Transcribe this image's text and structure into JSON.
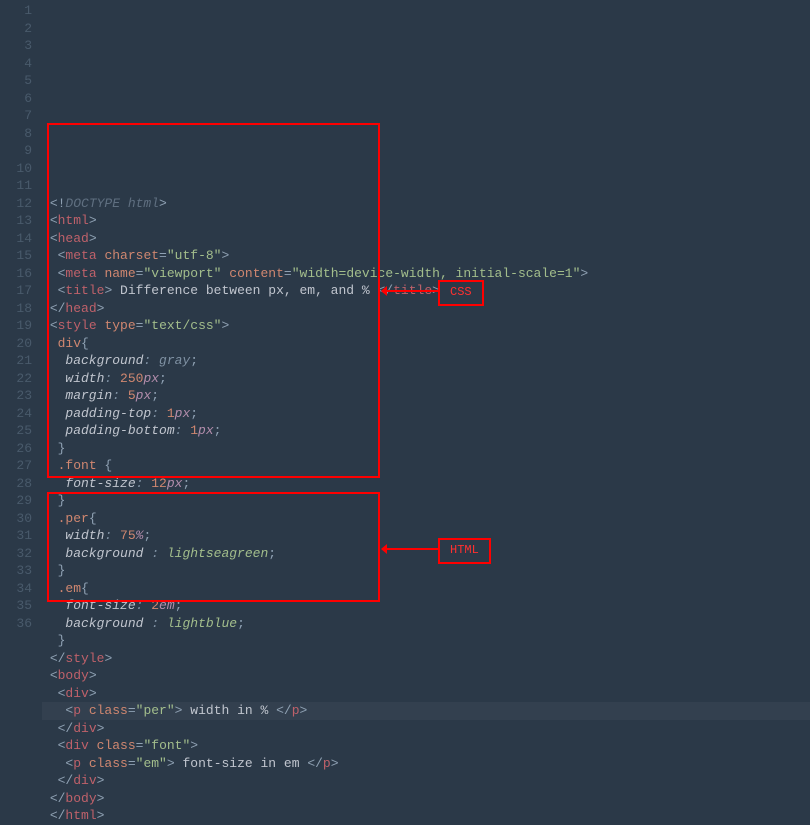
{
  "annotations": {
    "css_label": "CSS",
    "html_label": "HTML"
  },
  "lines": [
    {
      "n": 1,
      "segs": [
        {
          "t": " ",
          "c": ""
        },
        {
          "t": "<!",
          "c": "c-punct"
        },
        {
          "t": "DOCTYPE html",
          "c": "c-gray"
        },
        {
          "t": ">",
          "c": "c-punct"
        }
      ]
    },
    {
      "n": 2,
      "segs": [
        {
          "t": " ",
          "c": ""
        },
        {
          "t": "<",
          "c": "c-punct"
        },
        {
          "t": "html",
          "c": "c-tag"
        },
        {
          "t": ">",
          "c": "c-punct"
        }
      ]
    },
    {
      "n": 3,
      "segs": [
        {
          "t": " ",
          "c": ""
        },
        {
          "t": "<",
          "c": "c-punct"
        },
        {
          "t": "head",
          "c": "c-tag"
        },
        {
          "t": ">",
          "c": "c-punct"
        }
      ]
    },
    {
      "n": 4,
      "segs": [
        {
          "t": "  ",
          "c": ""
        },
        {
          "t": "<",
          "c": "c-punct"
        },
        {
          "t": "meta ",
          "c": "c-tag"
        },
        {
          "t": "charset",
          "c": "c-attr"
        },
        {
          "t": "=",
          "c": "c-punct"
        },
        {
          "t": "\"utf-8\"",
          "c": "c-str"
        },
        {
          "t": ">",
          "c": "c-punct"
        }
      ]
    },
    {
      "n": 5,
      "segs": [
        {
          "t": "  ",
          "c": ""
        },
        {
          "t": "<",
          "c": "c-punct"
        },
        {
          "t": "meta ",
          "c": "c-tag"
        },
        {
          "t": "name",
          "c": "c-attr"
        },
        {
          "t": "=",
          "c": "c-punct"
        },
        {
          "t": "\"viewport\"",
          "c": "c-str"
        },
        {
          "t": " ",
          "c": ""
        },
        {
          "t": "content",
          "c": "c-attr"
        },
        {
          "t": "=",
          "c": "c-punct"
        },
        {
          "t": "\"width=device-width, initial-scale=1\"",
          "c": "c-str"
        },
        {
          "t": ">",
          "c": "c-punct"
        }
      ]
    },
    {
      "n": 6,
      "segs": [
        {
          "t": "  ",
          "c": ""
        },
        {
          "t": "<",
          "c": "c-punct"
        },
        {
          "t": "title",
          "c": "c-tag"
        },
        {
          "t": ">",
          "c": "c-punct"
        },
        {
          "t": " Difference between px, em, and % ",
          "c": "c-text"
        },
        {
          "t": "</",
          "c": "c-punct"
        },
        {
          "t": "title",
          "c": "c-tag"
        },
        {
          "t": ">",
          "c": "c-punct"
        }
      ]
    },
    {
      "n": 7,
      "segs": [
        {
          "t": " ",
          "c": ""
        },
        {
          "t": "</",
          "c": "c-punct"
        },
        {
          "t": "head",
          "c": "c-tag"
        },
        {
          "t": ">",
          "c": "c-punct"
        }
      ]
    },
    {
      "n": 8,
      "segs": [
        {
          "t": " ",
          "c": ""
        },
        {
          "t": "<",
          "c": "c-punct"
        },
        {
          "t": "style ",
          "c": "c-tag"
        },
        {
          "t": "type",
          "c": "c-attr"
        },
        {
          "t": "=",
          "c": "c-punct"
        },
        {
          "t": "\"text/css\"",
          "c": "c-str"
        },
        {
          "t": ">",
          "c": "c-punct"
        }
      ]
    },
    {
      "n": 9,
      "segs": [
        {
          "t": "  ",
          "c": ""
        },
        {
          "t": "div",
          "c": "c-sel"
        },
        {
          "t": "{",
          "c": "c-punct"
        }
      ]
    },
    {
      "n": 10,
      "segs": [
        {
          "t": "   ",
          "c": ""
        },
        {
          "t": "background",
          "c": "c-prop"
        },
        {
          "t": ": ",
          "c": "c-kw"
        },
        {
          "t": "gray",
          "c": "c-kw"
        },
        {
          "t": ";",
          "c": "c-punct"
        }
      ]
    },
    {
      "n": 11,
      "segs": [
        {
          "t": "   ",
          "c": ""
        },
        {
          "t": "width",
          "c": "c-prop"
        },
        {
          "t": ": ",
          "c": "c-kw"
        },
        {
          "t": "250",
          "c": "c-num"
        },
        {
          "t": "px",
          "c": "c-unit"
        },
        {
          "t": ";",
          "c": "c-punct"
        }
      ]
    },
    {
      "n": 12,
      "segs": [
        {
          "t": "   ",
          "c": ""
        },
        {
          "t": "margin",
          "c": "c-prop"
        },
        {
          "t": ": ",
          "c": "c-kw"
        },
        {
          "t": "5",
          "c": "c-num"
        },
        {
          "t": "px",
          "c": "c-unit"
        },
        {
          "t": ";",
          "c": "c-punct"
        }
      ]
    },
    {
      "n": 13,
      "segs": [
        {
          "t": "   ",
          "c": ""
        },
        {
          "t": "padding-top",
          "c": "c-prop"
        },
        {
          "t": ": ",
          "c": "c-kw"
        },
        {
          "t": "1",
          "c": "c-num"
        },
        {
          "t": "px",
          "c": "c-unit"
        },
        {
          "t": ";",
          "c": "c-punct"
        }
      ]
    },
    {
      "n": 14,
      "segs": [
        {
          "t": "   ",
          "c": ""
        },
        {
          "t": "padding-bottom",
          "c": "c-prop"
        },
        {
          "t": ": ",
          "c": "c-kw"
        },
        {
          "t": "1",
          "c": "c-num"
        },
        {
          "t": "px",
          "c": "c-unit"
        },
        {
          "t": ";",
          "c": "c-punct"
        }
      ]
    },
    {
      "n": 15,
      "segs": [
        {
          "t": "  ",
          "c": ""
        },
        {
          "t": "}",
          "c": "c-punct"
        }
      ]
    },
    {
      "n": 16,
      "segs": [
        {
          "t": "  ",
          "c": ""
        },
        {
          "t": ".font ",
          "c": "c-sel"
        },
        {
          "t": "{",
          "c": "c-punct"
        }
      ]
    },
    {
      "n": 17,
      "segs": [
        {
          "t": "   ",
          "c": ""
        },
        {
          "t": "font-size",
          "c": "c-prop"
        },
        {
          "t": ": ",
          "c": "c-kw"
        },
        {
          "t": "12",
          "c": "c-num"
        },
        {
          "t": "px",
          "c": "c-unit"
        },
        {
          "t": ";",
          "c": "c-punct"
        }
      ]
    },
    {
      "n": 18,
      "segs": [
        {
          "t": "  ",
          "c": ""
        },
        {
          "t": "}",
          "c": "c-punct"
        }
      ]
    },
    {
      "n": 19,
      "segs": [
        {
          "t": "  ",
          "c": ""
        },
        {
          "t": ".per",
          "c": "c-sel"
        },
        {
          "t": "{",
          "c": "c-punct"
        }
      ]
    },
    {
      "n": 20,
      "segs": [
        {
          "t": "   ",
          "c": ""
        },
        {
          "t": "width",
          "c": "c-prop"
        },
        {
          "t": ": ",
          "c": "c-kw"
        },
        {
          "t": "75",
          "c": "c-num"
        },
        {
          "t": "%",
          "c": "c-unit"
        },
        {
          "t": ";",
          "c": "c-punct"
        }
      ]
    },
    {
      "n": 21,
      "segs": [
        {
          "t": "   ",
          "c": ""
        },
        {
          "t": "background ",
          "c": "c-prop"
        },
        {
          "t": ": ",
          "c": "c-kw"
        },
        {
          "t": "lightseagreen",
          "c": "c-val"
        },
        {
          "t": ";",
          "c": "c-punct"
        }
      ]
    },
    {
      "n": 22,
      "segs": [
        {
          "t": "  ",
          "c": ""
        },
        {
          "t": "}",
          "c": "c-punct"
        }
      ]
    },
    {
      "n": 23,
      "segs": [
        {
          "t": "  ",
          "c": ""
        },
        {
          "t": ".em",
          "c": "c-sel"
        },
        {
          "t": "{",
          "c": "c-punct"
        }
      ]
    },
    {
      "n": 24,
      "segs": [
        {
          "t": "   ",
          "c": ""
        },
        {
          "t": "font-size",
          "c": "c-prop"
        },
        {
          "t": ": ",
          "c": "c-kw"
        },
        {
          "t": "2",
          "c": "c-num"
        },
        {
          "t": "em",
          "c": "c-unit"
        },
        {
          "t": ";",
          "c": "c-punct"
        }
      ]
    },
    {
      "n": 25,
      "segs": [
        {
          "t": "   ",
          "c": ""
        },
        {
          "t": "background ",
          "c": "c-prop"
        },
        {
          "t": ": ",
          "c": "c-kw"
        },
        {
          "t": "lightblue",
          "c": "c-val"
        },
        {
          "t": ";",
          "c": "c-punct"
        }
      ]
    },
    {
      "n": 26,
      "segs": [
        {
          "t": "  ",
          "c": ""
        },
        {
          "t": "}",
          "c": "c-punct"
        }
      ]
    },
    {
      "n": 27,
      "segs": [
        {
          "t": " ",
          "c": ""
        },
        {
          "t": "</",
          "c": "c-punct"
        },
        {
          "t": "style",
          "c": "c-tag"
        },
        {
          "t": ">",
          "c": "c-punct"
        }
      ]
    },
    {
      "n": 28,
      "segs": [
        {
          "t": " ",
          "c": ""
        },
        {
          "t": "<",
          "c": "c-punct"
        },
        {
          "t": "body",
          "c": "c-tag"
        },
        {
          "t": ">",
          "c": "c-punct"
        }
      ]
    },
    {
      "n": 29,
      "segs": [
        {
          "t": "  ",
          "c": ""
        },
        {
          "t": "<",
          "c": "c-punct"
        },
        {
          "t": "div",
          "c": "c-tag"
        },
        {
          "t": ">",
          "c": "c-punct"
        }
      ]
    },
    {
      "n": 30,
      "hl": true,
      "segs": [
        {
          "t": "   ",
          "c": ""
        },
        {
          "t": "<",
          "c": "c-punct"
        },
        {
          "t": "p ",
          "c": "c-tag"
        },
        {
          "t": "class",
          "c": "c-attr"
        },
        {
          "t": "=",
          "c": "c-punct"
        },
        {
          "t": "\"per\"",
          "c": "c-str"
        },
        {
          "t": ">",
          "c": "c-punct"
        },
        {
          "t": " width in % ",
          "c": "c-text"
        },
        {
          "t": "</",
          "c": "c-punct"
        },
        {
          "t": "p",
          "c": "c-tag"
        },
        {
          "t": ">",
          "c": "c-punct"
        }
      ]
    },
    {
      "n": 31,
      "segs": [
        {
          "t": "  ",
          "c": ""
        },
        {
          "t": "</",
          "c": "c-punct"
        },
        {
          "t": "div",
          "c": "c-tag"
        },
        {
          "t": ">",
          "c": "c-punct"
        }
      ]
    },
    {
      "n": 32,
      "segs": [
        {
          "t": "  ",
          "c": ""
        },
        {
          "t": "<",
          "c": "c-punct"
        },
        {
          "t": "div ",
          "c": "c-tag"
        },
        {
          "t": "class",
          "c": "c-attr"
        },
        {
          "t": "=",
          "c": "c-punct"
        },
        {
          "t": "\"font\"",
          "c": "c-str"
        },
        {
          "t": ">",
          "c": "c-punct"
        }
      ]
    },
    {
      "n": 33,
      "segs": [
        {
          "t": "   ",
          "c": ""
        },
        {
          "t": "<",
          "c": "c-punct"
        },
        {
          "t": "p ",
          "c": "c-tag"
        },
        {
          "t": "class",
          "c": "c-attr"
        },
        {
          "t": "=",
          "c": "c-punct"
        },
        {
          "t": "\"em\"",
          "c": "c-str"
        },
        {
          "t": ">",
          "c": "c-punct"
        },
        {
          "t": " font-size in em ",
          "c": "c-text"
        },
        {
          "t": "</",
          "c": "c-punct"
        },
        {
          "t": "p",
          "c": "c-tag"
        },
        {
          "t": ">",
          "c": "c-punct"
        }
      ]
    },
    {
      "n": 34,
      "segs": [
        {
          "t": "  ",
          "c": ""
        },
        {
          "t": "</",
          "c": "c-punct"
        },
        {
          "t": "div",
          "c": "c-tag"
        },
        {
          "t": ">",
          "c": "c-punct"
        }
      ]
    },
    {
      "n": 35,
      "segs": [
        {
          "t": " ",
          "c": ""
        },
        {
          "t": "</",
          "c": "c-punct"
        },
        {
          "t": "body",
          "c": "c-tag"
        },
        {
          "t": ">",
          "c": "c-punct"
        }
      ]
    },
    {
      "n": 36,
      "segs": [
        {
          "t": " ",
          "c": ""
        },
        {
          "t": "</",
          "c": "c-punct"
        },
        {
          "t": "html",
          "c": "c-tag"
        },
        {
          "t": ">",
          "c": "c-punct"
        }
      ]
    }
  ]
}
